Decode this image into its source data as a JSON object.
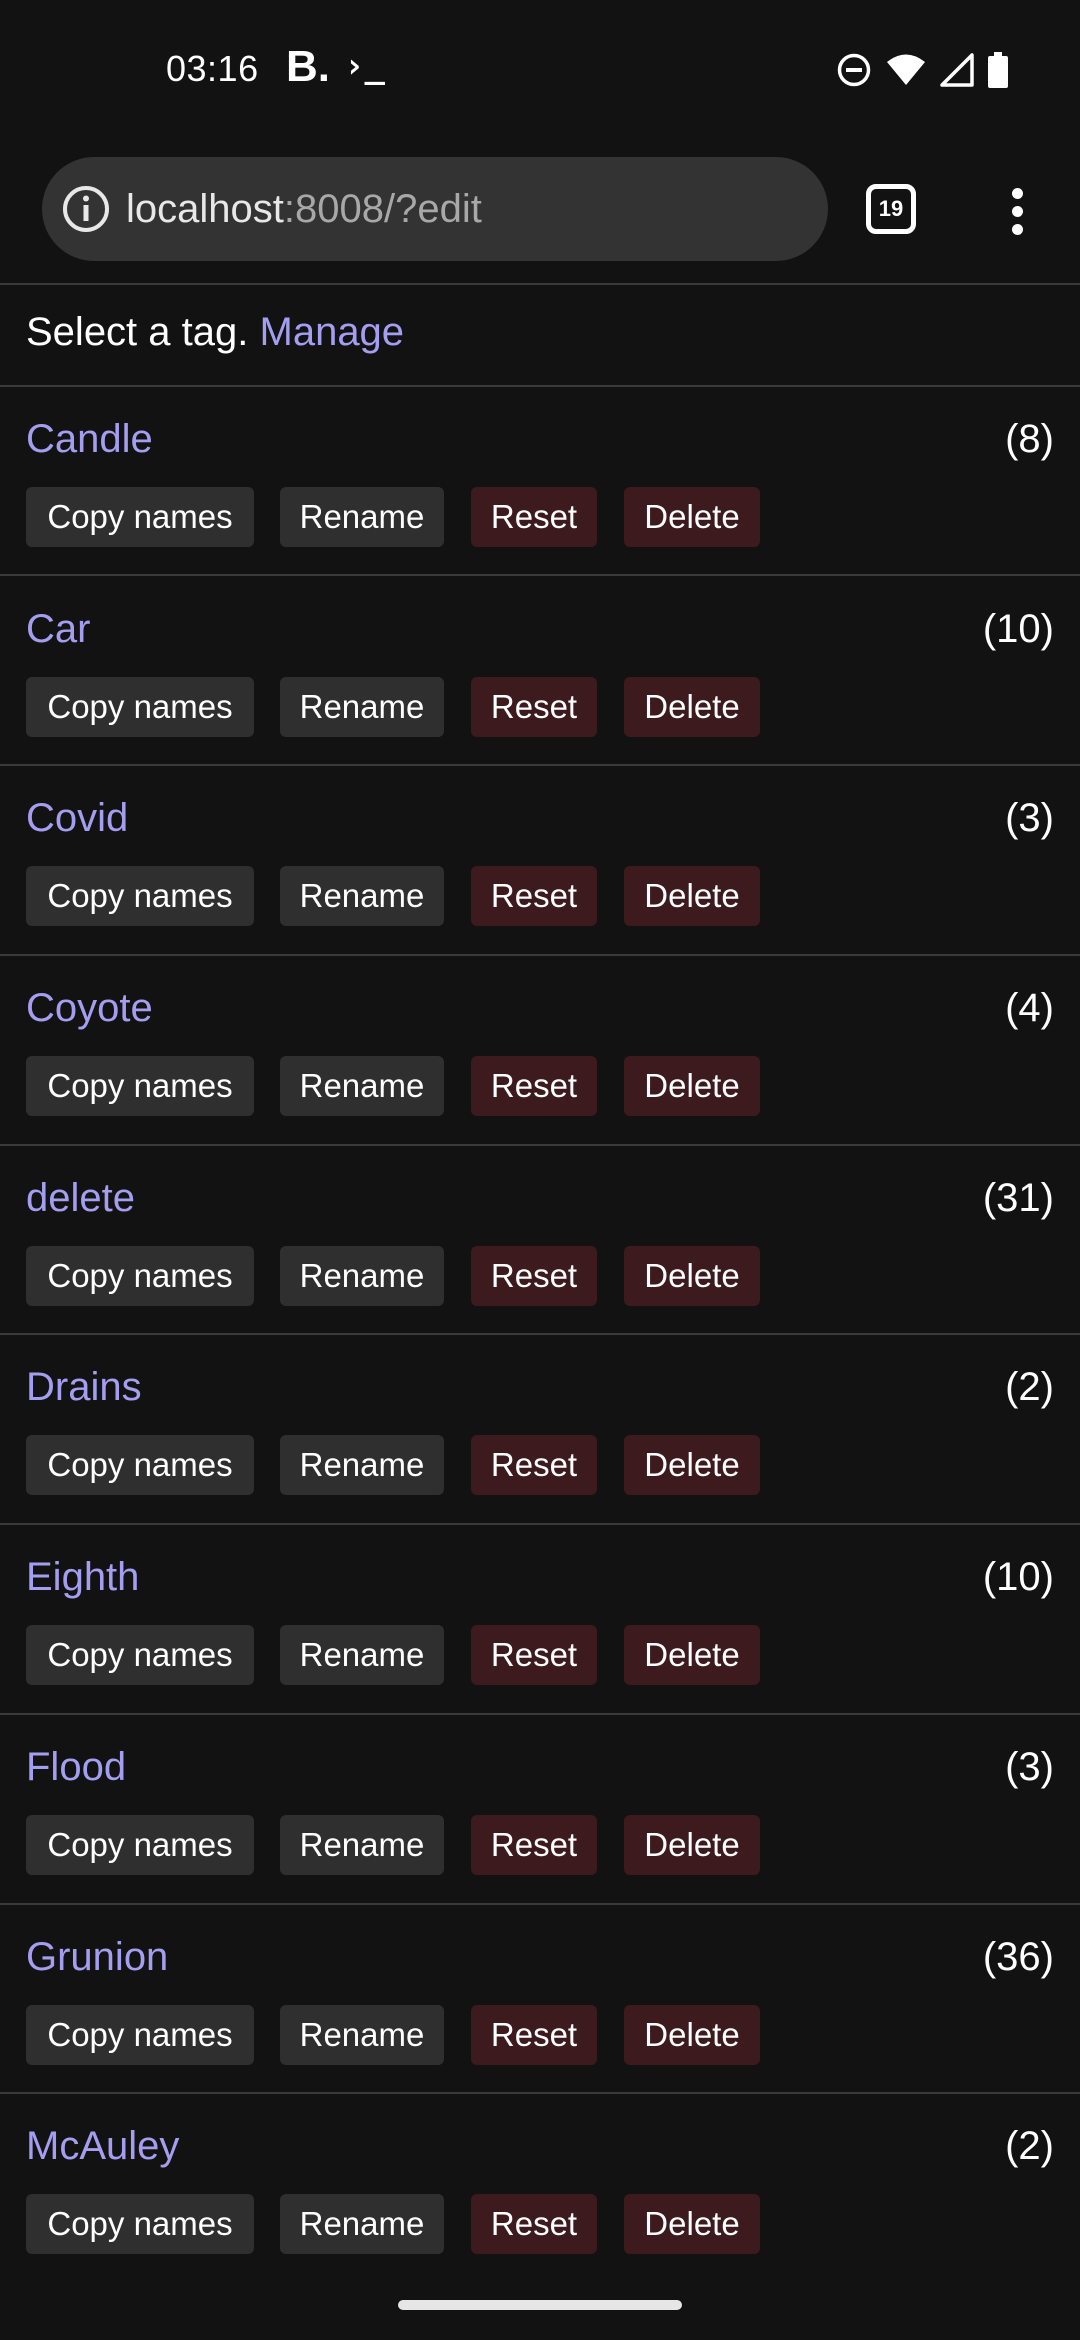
{
  "status_bar": {
    "time": "03:16",
    "app_icon_b": "B.",
    "app_icon_terminal": "›_",
    "icons": [
      "do-not-disturb-icon",
      "wifi-icon",
      "cell-signal-icon",
      "battery-icon"
    ]
  },
  "browser": {
    "url_host": "localhost",
    "url_rest": ":8008/?edit",
    "tab_count": "19",
    "menu_icon": "more-vert-icon"
  },
  "page": {
    "prompt": "Select a tag.",
    "manage_label": "Manage",
    "buttons": {
      "copy": "Copy names",
      "rename": "Rename",
      "reset": "Reset",
      "delete": "Delete"
    },
    "tags": [
      {
        "name": "Candle",
        "count": "(8)"
      },
      {
        "name": "Car",
        "count": "(10)"
      },
      {
        "name": "Covid",
        "count": "(3)"
      },
      {
        "name": "Coyote",
        "count": "(4)"
      },
      {
        "name": "delete",
        "count": "(31)"
      },
      {
        "name": "Drains",
        "count": "(2)"
      },
      {
        "name": "Eighth",
        "count": "(10)"
      },
      {
        "name": "Flood",
        "count": "(3)"
      },
      {
        "name": "Grunion",
        "count": "(36)"
      },
      {
        "name": "McAuley",
        "count": "(2)"
      }
    ]
  },
  "colors": {
    "background": "#121212",
    "link": "#a49ef0",
    "neutral_button": "#2f2f2f",
    "danger_button": "#3c1a1e",
    "divider": "#3a3a3a"
  }
}
